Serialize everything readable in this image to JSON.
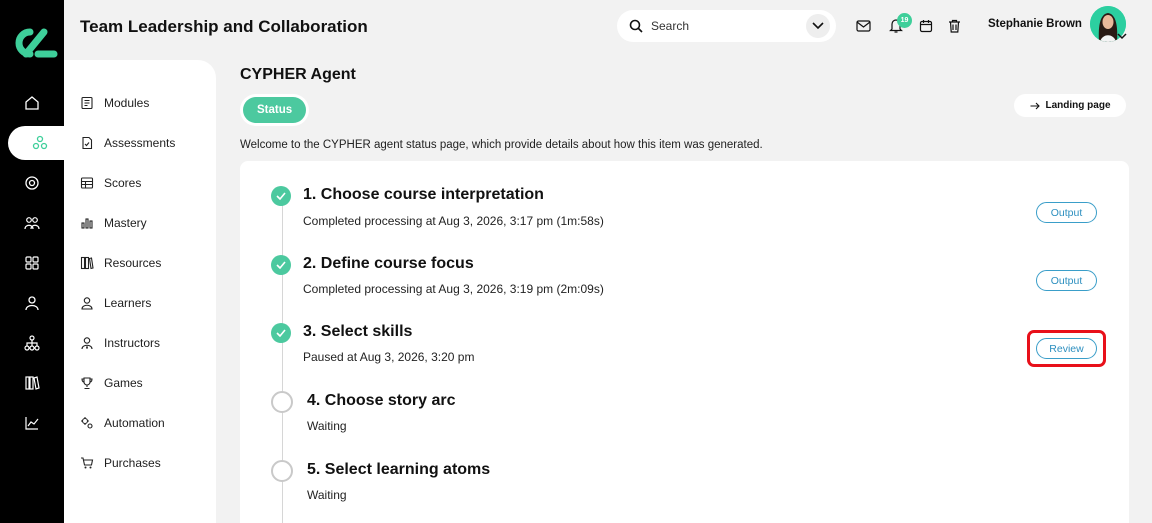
{
  "header": {
    "app_title": "Team Leadership and Collaboration",
    "search_placeholder": "Search",
    "notification_count": "19",
    "user_name": "Stephanie Brown"
  },
  "rail": {
    "icons": [
      "home-icon",
      "network-icon",
      "target-icon",
      "people-icon",
      "grid-icon",
      "person-icon",
      "org-chart-icon",
      "library-icon",
      "trend-icon"
    ],
    "active_index": 1
  },
  "subnav": {
    "items": [
      {
        "label": "Modules",
        "icon": "module-icon"
      },
      {
        "label": "Assessments",
        "icon": "assessment-icon"
      },
      {
        "label": "Scores",
        "icon": "table-icon"
      },
      {
        "label": "Mastery",
        "icon": "bar-chart-icon"
      },
      {
        "label": "Resources",
        "icon": "books-icon"
      },
      {
        "label": "Learners",
        "icon": "learner-icon"
      },
      {
        "label": "Instructors",
        "icon": "instructor-icon"
      },
      {
        "label": "Games",
        "icon": "trophy-icon"
      },
      {
        "label": "Automation",
        "icon": "gears-icon"
      },
      {
        "label": "Purchases",
        "icon": "cart-icon"
      }
    ]
  },
  "main": {
    "title": "CYPHER Agent",
    "status_tab": "Status",
    "landing_button": "Landing page",
    "intro": "Welcome to the CYPHER agent status page, which provide details about how this item was generated.",
    "steps": [
      {
        "title": "1. Choose course interpretation",
        "subtitle": "Completed processing at Aug 3, 2026, 3:17 pm (1m:58s)",
        "state": "done",
        "action": "Output"
      },
      {
        "title": "2. Define course focus",
        "subtitle": "Completed processing at Aug 3, 2026, 3:19 pm (2m:09s)",
        "state": "done",
        "action": "Output"
      },
      {
        "title": "3. Select skills",
        "subtitle": "Paused at Aug 3, 2026, 3:20 pm",
        "state": "done",
        "action": "Review"
      },
      {
        "title": "4. Choose story arc",
        "subtitle": "Waiting",
        "state": "wait",
        "action": ""
      },
      {
        "title": "5. Select learning atoms",
        "subtitle": "Waiting",
        "state": "wait",
        "action": ""
      }
    ]
  },
  "colors": {
    "accent": "#4cc99f",
    "button_outline": "#3a9ec9",
    "highlight": "#e8101a"
  }
}
